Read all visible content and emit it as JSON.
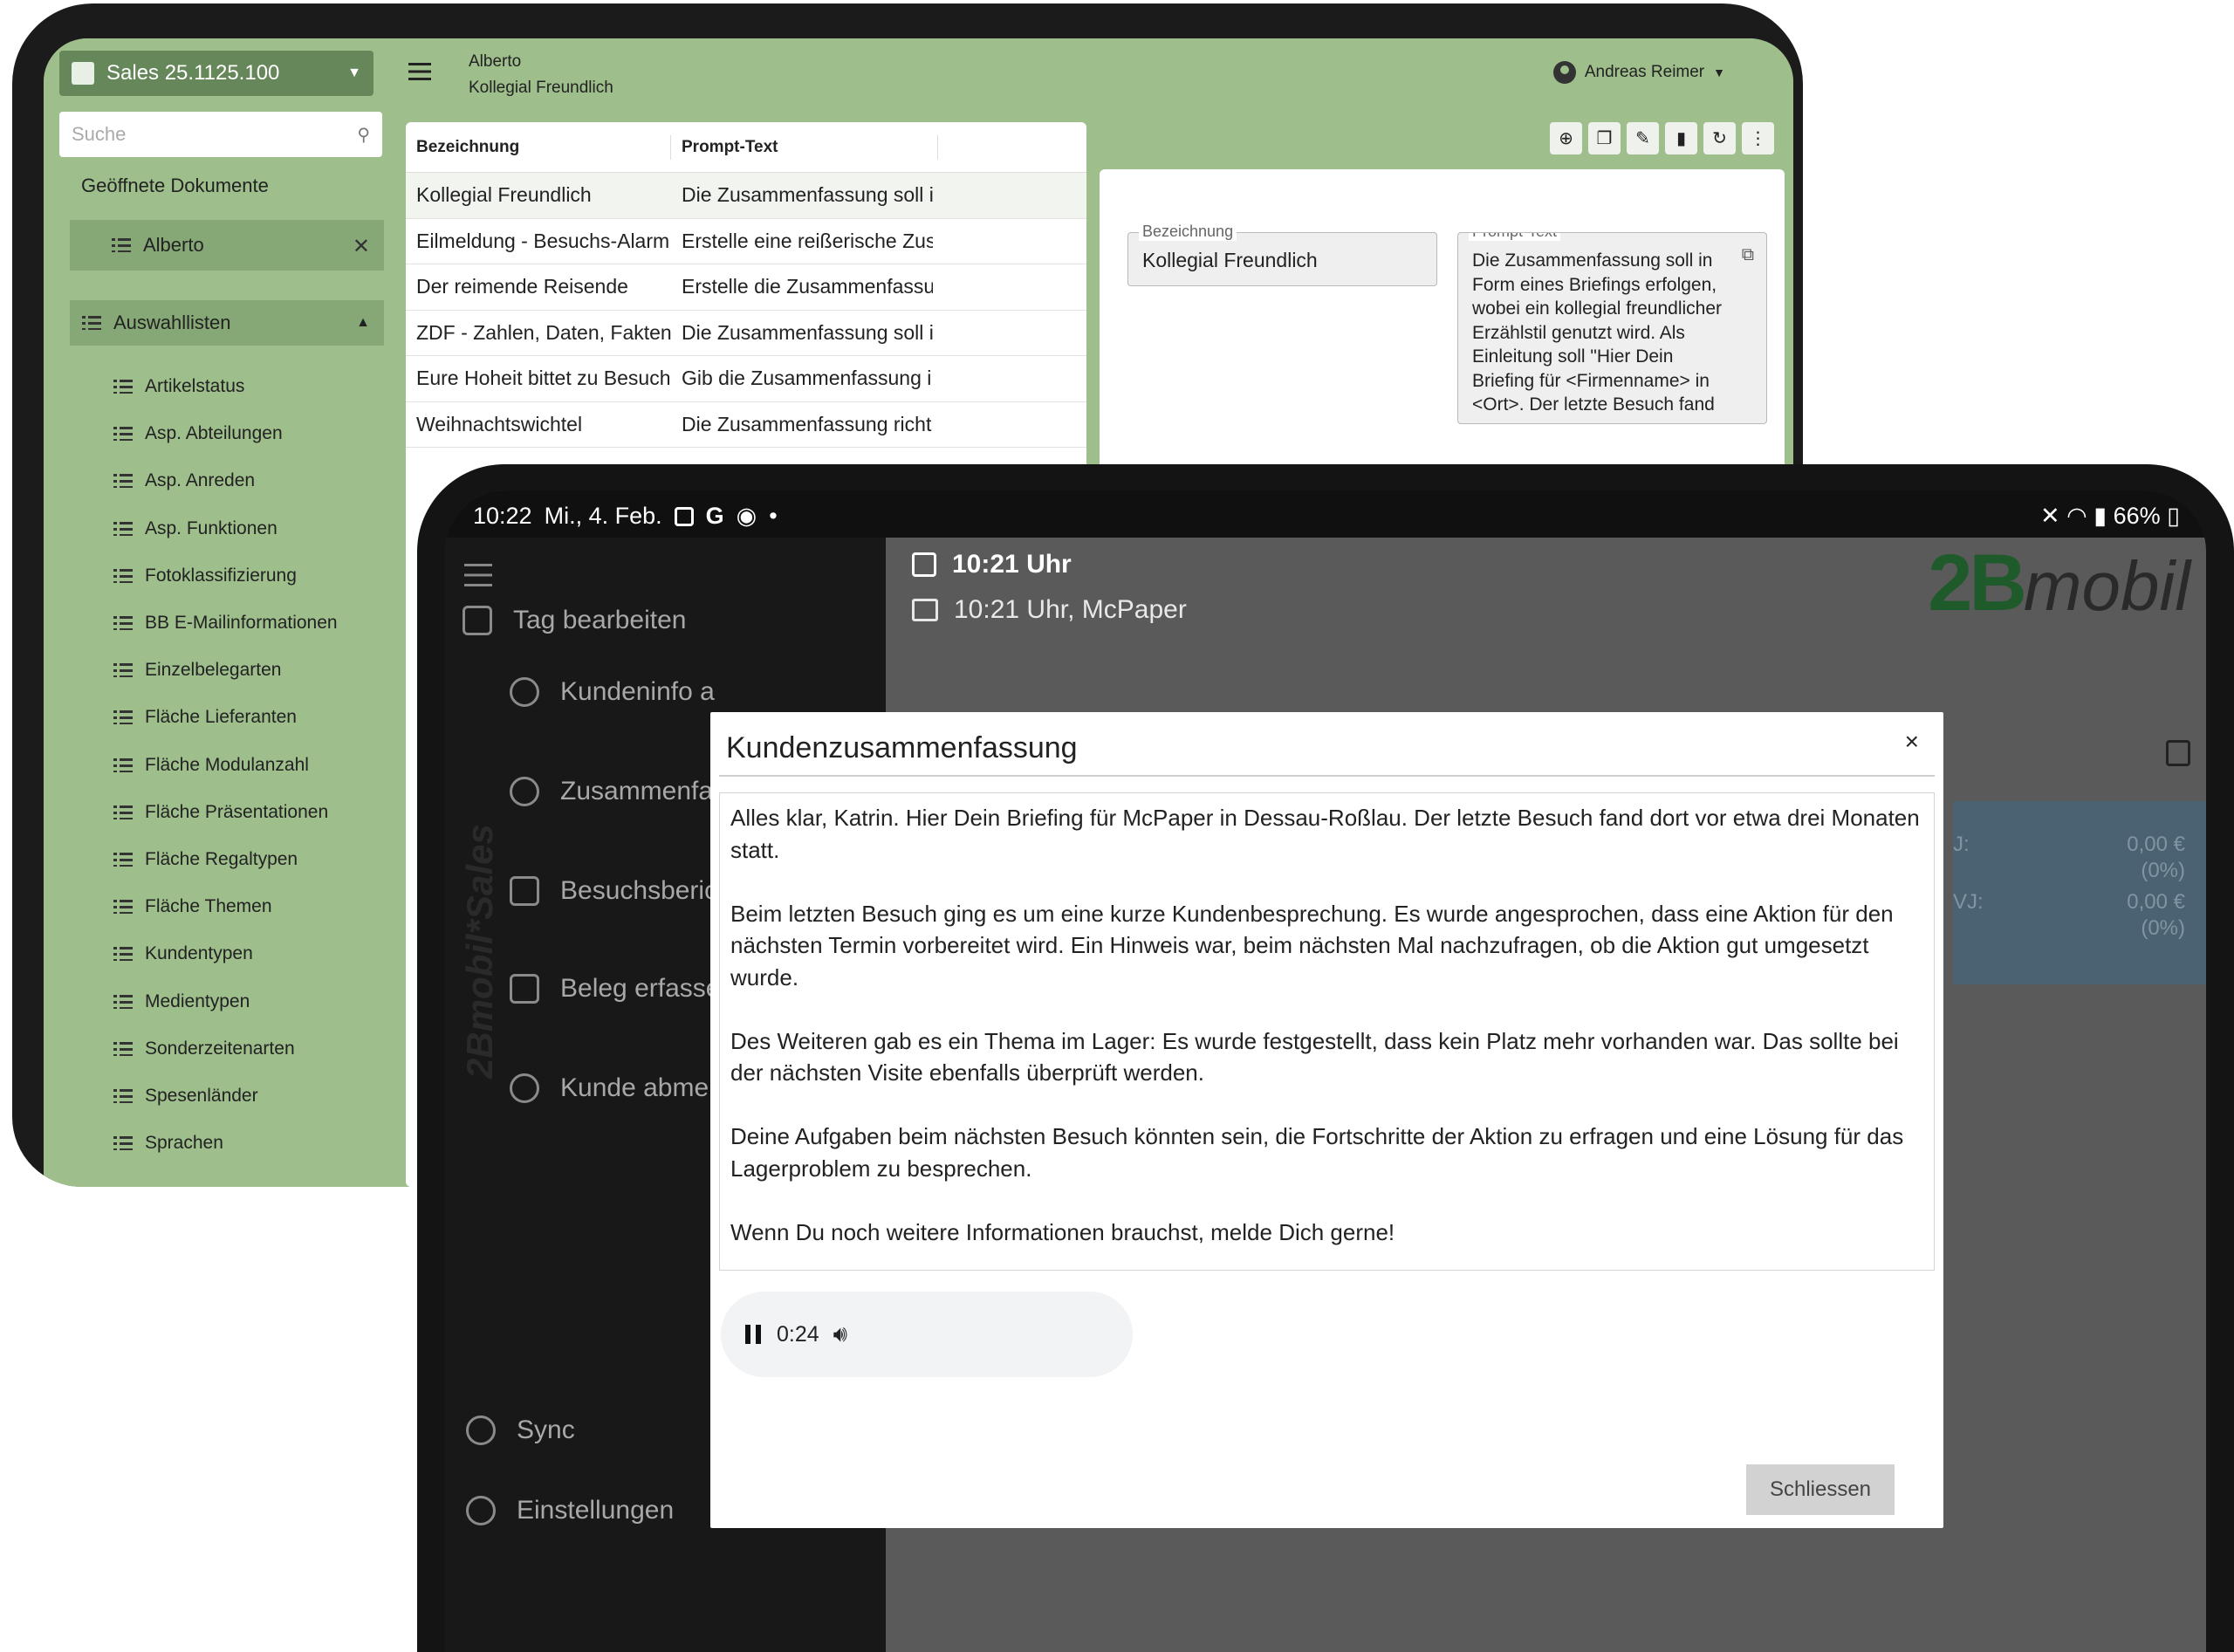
{
  "back": {
    "app_switcher": "Sales 25.1125.100",
    "search_placeholder": "Suche",
    "open_docs_title": "Geöffnete Dokumente",
    "open_doc": "Alberto",
    "lists_title": "Auswahllisten",
    "lists": [
      "Artikelstatus",
      "Asp. Abteilungen",
      "Asp. Anreden",
      "Asp. Funktionen",
      "Fotoklassifizierung",
      "BB E-Mailinformationen",
      "Einzelbelegarten",
      "Fläche Lieferanten",
      "Fläche Modulanzahl",
      "Fläche Präsentationen",
      "Fläche Regaltypen",
      "Fläche Themen",
      "Kundentypen",
      "Medientypen",
      "Sonderzeitenarten",
      "Spesenländer",
      "Sprachen"
    ],
    "topbar": {
      "title": "Alberto",
      "subtitle": "Kollegial Freundlich",
      "user": "Andreas Reimer"
    },
    "grid": {
      "headers": [
        "Bezeichnung",
        "Prompt-Text"
      ],
      "rows": [
        [
          "Kollegial Freundlich",
          "Die Zusammenfassung soll i..."
        ],
        [
          "Eilmeldung - Besuchs-Alarm",
          "Erstelle eine reißerische Zus..."
        ],
        [
          "Der reimende Reisende",
          "Erstelle die Zusammenfassu..."
        ],
        [
          "ZDF - Zahlen, Daten, Fakten",
          "Die Zusammenfassung soll i..."
        ],
        [
          "Eure Hoheit bittet zu Besuch",
          "Gib die Zusammenfassung i..."
        ],
        [
          "Weihnachtswichtel",
          "Die Zusammenfassung richt..."
        ]
      ]
    },
    "detail": {
      "label_name": "Bezeichnung",
      "value_name": "Kollegial Freundlich",
      "label_prompt": "Prompt-Text",
      "value_prompt": "Die Zusammenfassung soll in Form eines Briefings erfolgen, wobei ein kollegial freundlicher Erzählstil genutzt wird. Als Einleitung soll \"Hier Dein Briefing für <Firmenname> in <Ort>. Der letzte Besuch fand"
    }
  },
  "front": {
    "status": {
      "time": "10:22",
      "date": "Mi., 4. Feb.",
      "battery": "66%"
    },
    "drawer": {
      "day": "Tag bearbeiten",
      "customer_info": "Kundeninfo a",
      "summary": "Zusammenfas",
      "visit_report": "Besuchsberic",
      "receipt": "Beleg erfasse",
      "checkout": "Kunde abmel",
      "sync": "Sync",
      "settings": "Einstellungen",
      "brand": "2Bmobil*Sales"
    },
    "content": {
      "time": "10:21 Uhr",
      "time_store": "10:21 Uhr, McPaper",
      "logo_digits": "2B",
      "logo_word": "mobil",
      "stats": [
        "J:",
        "0,00 €",
        "(0%)",
        "VJ:",
        "0,00 €",
        "(0%)"
      ]
    },
    "modal": {
      "title": "Kundenzusammenfassung",
      "close": "×",
      "paragraphs": [
        "Alles klar, Katrin. Hier Dein Briefing für McPaper in Dessau-Roßlau. Der letzte Besuch fand dort vor etwa drei Monaten statt.",
        "Beim letzten Besuch ging es um eine kurze Kundenbesprechung. Es wurde angesprochen, dass eine Aktion für den nächsten Termin vorbereitet wird. Ein Hinweis war, beim nächsten Mal nachzufragen, ob die Aktion gut umgesetzt wurde.",
        "Des Weiteren gab es ein Thema im Lager: Es wurde festgestellt, dass kein Platz mehr vorhanden war. Das sollte bei der nächsten Visite ebenfalls überprüft werden.",
        "Deine Aufgaben beim nächsten Besuch könnten sein, die Fortschritte der Aktion zu erfragen und eine Lösung für das Lagerproblem zu besprechen.",
        "Wenn Du noch weitere Informationen brauchst, melde Dich gerne!"
      ],
      "player_time": "0:24",
      "close_button": "Schliessen"
    }
  }
}
